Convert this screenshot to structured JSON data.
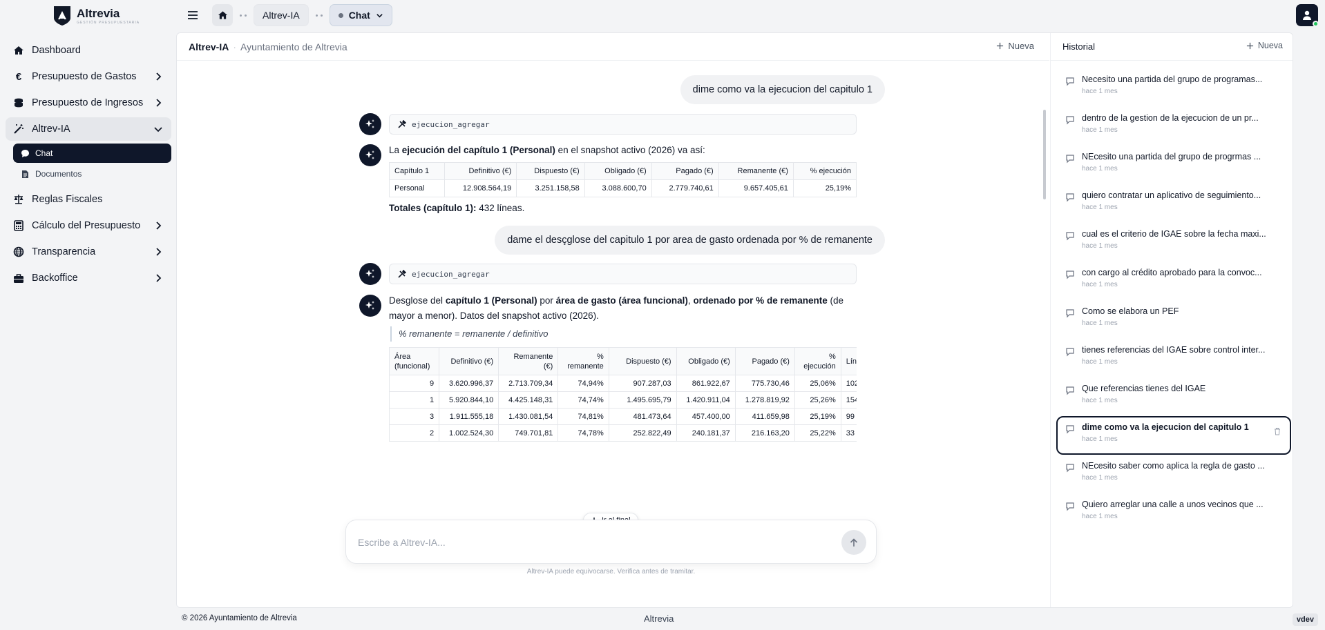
{
  "brand": {
    "name": "Altrevia",
    "tagline": "GESTIÓN PRESUPUESTARIA"
  },
  "sidebar": {
    "items": [
      {
        "label": "Dashboard",
        "icon": "home-icon"
      },
      {
        "label": "Presupuesto de Gastos",
        "icon": "euro-icon"
      },
      {
        "label": "Presupuesto de Ingresos",
        "icon": "coins-icon"
      },
      {
        "label": "Altrev-IA",
        "icon": "magic-wand-icon"
      },
      {
        "label": "Reglas Fiscales",
        "icon": "scale-icon"
      },
      {
        "label": "Cálculo del Presupuesto",
        "icon": "calculator-icon"
      },
      {
        "label": "Transparencia",
        "icon": "globe-icon"
      },
      {
        "label": "Backoffice",
        "icon": "briefcase-icon"
      }
    ],
    "sub": [
      {
        "label": "Chat",
        "icon": "chat-icon"
      },
      {
        "label": "Documentos",
        "icon": "document-icon"
      }
    ]
  },
  "breadcrumb": {
    "section": "Altrev-IA",
    "current": "Chat"
  },
  "chat": {
    "title": "Altrev-IA",
    "subtitle": "Ayuntamiento de Altrevia",
    "new_label": "Nueva",
    "messages": {
      "u1": "dime como va la ejecucion del capitulo 1",
      "tool1": "ejecucion_agregar",
      "a1_pre": "La ",
      "a1_b": "ejecución del capítulo 1 (Personal)",
      "a1_post": " en el snapshot activo (2026) va así:",
      "t1_head": [
        "Capítulo 1",
        "Definitivo (€)",
        "Dispuesto (€)",
        "Obligado (€)",
        "Pagado (€)",
        "Remanente (€)",
        "% ejecución"
      ],
      "t1_row": [
        "Personal",
        "12.908.564,19",
        "3.251.158,58",
        "3.088.600,70",
        "2.779.740,61",
        "9.657.405,61",
        "25,19%"
      ],
      "tot_b": "Totales (capítulo 1):",
      "tot_rest": " 432 líneas.",
      "u2": "dame el desçglose del capitulo 1 por area de gasto ordenada por % de remanente",
      "tool2": "ejecucion_agregar",
      "a2_1": "Desglose del ",
      "a2_b1": "capítulo 1 (Personal)",
      "a2_2": " por ",
      "a2_b2": "área de gasto (área funcional)",
      "a2_3": ", ",
      "a2_b3": "ordenado por % de remanente",
      "a2_4": " (de mayor a menor). Datos del snapshot activo (2026).",
      "quote": "% remanente = remanente / definitivo",
      "t2_head": [
        "Área (funcional)",
        "Definitivo (€)",
        "Remanente (€)",
        "% remanente",
        "Dispuesto (€)",
        "Obligado (€)",
        "Pagado (€)",
        "% ejecución",
        "Líneas"
      ],
      "t2_rows": [
        [
          "9",
          "3.620.996,37",
          "2.713.709,34",
          "74,94%",
          "907.287,03",
          "861.922,67",
          "775.730,46",
          "25,06%",
          "102"
        ],
        [
          "1",
          "5.920.844,10",
          "4.425.148,31",
          "74,74%",
          "1.495.695,79",
          "1.420.911,04",
          "1.278.819,92",
          "25,26%",
          "154"
        ],
        [
          "3",
          "1.911.555,18",
          "1.430.081,54",
          "74,81%",
          "481.473,64",
          "457.400,00",
          "411.659,98",
          "25,19%",
          "99"
        ],
        [
          "2",
          "1.002.524,30",
          "749.701,81",
          "74,78%",
          "252.822,49",
          "240.181,37",
          "216.163,20",
          "25,22%",
          "33"
        ]
      ]
    },
    "go_end": "Ir al final",
    "placeholder": "Escribe a Altrev-IA...",
    "disclaimer": "Altrev-IA puede equivocarse. Verifica antes de tramitar."
  },
  "history": {
    "title": "Historial",
    "new_label": "Nueva",
    "items": [
      {
        "title": "Necesito una partida del grupo de programas...",
        "ago": "hace 1 mes"
      },
      {
        "title": "dentro de la gestion de la ejecucion de un pr...",
        "ago": "hace 1 mes"
      },
      {
        "title": "NEcesito una partida del grupo de progrmas ...",
        "ago": "hace 1 mes"
      },
      {
        "title": "quiero contratar un aplicativo de seguimiento...",
        "ago": "hace 1 mes"
      },
      {
        "title": "cual es el criterio de IGAE sobre la fecha maxi...",
        "ago": "hace 1 mes"
      },
      {
        "title": "con cargo al crédito aprobado para la convoc...",
        "ago": "hace 1 mes"
      },
      {
        "title": "Como se elabora un PEF",
        "ago": "hace 1 mes"
      },
      {
        "title": "tienes referencias del IGAE sobre control inter...",
        "ago": "hace 1 mes"
      },
      {
        "title": "Que referencias tienes del IGAE",
        "ago": "hace 1 mes"
      },
      {
        "title": "dime como va la ejecucion del capitulo 1",
        "ago": "hace 1 mes"
      },
      {
        "title": "NEcesito saber como aplica la regla de gasto ...",
        "ago": "hace 1 mes"
      },
      {
        "title": "Quiero arreglar una calle a unos vecinos que ...",
        "ago": "hace 1 mes"
      }
    ]
  },
  "footer": {
    "copyright": "© 2026 Ayuntamiento de Altrevia",
    "center": "Altrevia",
    "version": "vdev"
  }
}
